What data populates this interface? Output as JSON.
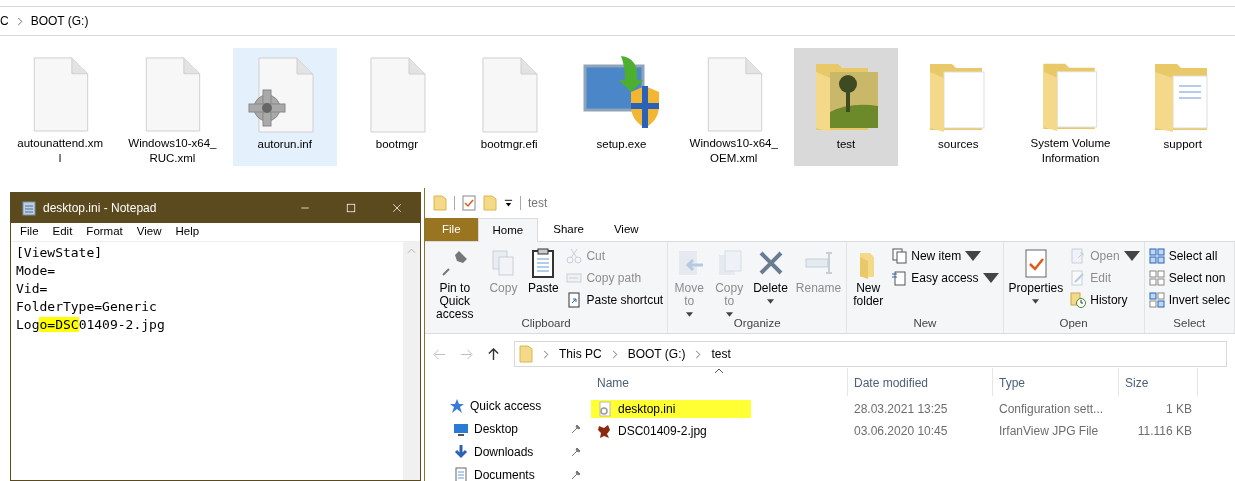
{
  "background_explorer": {
    "breadcrumb": [
      "C",
      "BOOT (G:)"
    ],
    "items": [
      {
        "lines": [
          "autounattend.xm",
          "l"
        ],
        "kind": "file",
        "selected": false,
        "hovered": false
      },
      {
        "lines": [
          "Windows10-x64_",
          "RUC.xml"
        ],
        "kind": "file",
        "selected": false,
        "hovered": false
      },
      {
        "lines": [
          "autorun.inf"
        ],
        "kind": "settings-file",
        "selected": false,
        "hovered": true
      },
      {
        "lines": [
          "bootmgr"
        ],
        "kind": "file",
        "selected": false,
        "hovered": false
      },
      {
        "lines": [
          "bootmgr.efi"
        ],
        "kind": "file",
        "selected": false,
        "hovered": false
      },
      {
        "lines": [
          "setup.exe"
        ],
        "kind": "setup",
        "selected": false,
        "hovered": false
      },
      {
        "lines": [
          "Windows10-x64_",
          "OEM.xml"
        ],
        "kind": "file",
        "selected": false,
        "hovered": false
      },
      {
        "lines": [
          "test"
        ],
        "kind": "photo-folder",
        "selected": true,
        "hovered": false
      },
      {
        "lines": [
          "sources"
        ],
        "kind": "folder",
        "selected": false,
        "hovered": false
      },
      {
        "lines": [
          "System Volume",
          "Information"
        ],
        "kind": "folder",
        "selected": false,
        "hovered": false
      },
      {
        "lines": [
          "support"
        ],
        "kind": "doc-folder",
        "selected": false,
        "hovered": false
      }
    ]
  },
  "notepad": {
    "title": "desktop.ini - Notepad",
    "menu": [
      "File",
      "Edit",
      "Format",
      "View",
      "Help"
    ],
    "lines": [
      {
        "segments": [
          {
            "text": "[ViewState]",
            "highlighted": false
          }
        ]
      },
      {
        "segments": [
          {
            "text": "Mode=",
            "highlighted": false
          }
        ]
      },
      {
        "segments": [
          {
            "text": "Vid=",
            "highlighted": false
          }
        ]
      },
      {
        "segments": [
          {
            "text": "FolderType=Generic",
            "highlighted": false
          }
        ]
      },
      {
        "segments": [
          {
            "text": "Log",
            "highlighted": false
          },
          {
            "text": "o=DSC",
            "highlighted": true
          },
          {
            "text": "01409-2.jpg",
            "highlighted": false
          }
        ]
      }
    ]
  },
  "explorer": {
    "title": "test",
    "tabs": [
      {
        "label": "File",
        "kind": "file-menu",
        "selected": false
      },
      {
        "label": "Home",
        "kind": "tab",
        "selected": true
      },
      {
        "label": "Share",
        "kind": "tab",
        "selected": false
      },
      {
        "label": "View",
        "kind": "tab",
        "selected": false
      }
    ],
    "ribbon": [
      {
        "label": "Clipboard",
        "items": [
          {
            "kind": "pin",
            "lines": [
              "Pin to Quick",
              "access"
            ],
            "disabled": false,
            "dropdown": false
          },
          {
            "kind": "copy",
            "lines": [
              "Copy"
            ],
            "disabled": true,
            "dropdown": false
          },
          {
            "kind": "paste",
            "lines": [
              "Paste"
            ],
            "disabled": false,
            "dropdown": false
          },
          {
            "kind": "stack",
            "items": [
              {
                "kind": "cut",
                "label": "Cut",
                "disabled": true,
                "dropdown": false
              },
              {
                "kind": "copypath",
                "label": "Copy path",
                "disabled": true,
                "dropdown": false
              },
              {
                "kind": "shortcut",
                "label": "Paste shortcut",
                "disabled": false,
                "dropdown": false
              }
            ]
          }
        ]
      },
      {
        "label": "Organize",
        "items": [
          {
            "kind": "move",
            "lines": [
              "Move",
              "to"
            ],
            "disabled": true,
            "dropdown": true
          },
          {
            "kind": "copyto",
            "lines": [
              "Copy",
              "to"
            ],
            "disabled": true,
            "dropdown": true
          },
          {
            "kind": "delete",
            "lines": [
              "Delete"
            ],
            "disabled": false,
            "dropdown": true
          },
          {
            "kind": "rename",
            "lines": [
              "Rename"
            ],
            "disabled": true,
            "dropdown": false
          }
        ]
      },
      {
        "label": "New",
        "items": [
          {
            "kind": "newfolder",
            "lines": [
              "New",
              "folder"
            ],
            "disabled": false,
            "dropdown": false
          },
          {
            "kind": "stack",
            "items": [
              {
                "kind": "newitem",
                "label": "New item",
                "disabled": false,
                "dropdown": true
              },
              {
                "kind": "easyaccess",
                "label": "Easy access",
                "disabled": false,
                "dropdown": true
              }
            ]
          }
        ]
      },
      {
        "label": "Open",
        "items": [
          {
            "kind": "properties",
            "lines": [
              "Properties"
            ],
            "disabled": false,
            "dropdown": true
          },
          {
            "kind": "stack",
            "items": [
              {
                "kind": "open",
                "label": "Open",
                "disabled": true,
                "dropdown": true
              },
              {
                "kind": "edit",
                "label": "Edit",
                "disabled": true,
                "dropdown": false
              },
              {
                "kind": "history",
                "label": "History",
                "disabled": false,
                "dropdown": false
              }
            ]
          }
        ]
      },
      {
        "label": "Select",
        "items": [
          {
            "kind": "stack",
            "items": [
              {
                "kind": "selectall",
                "label": "Select all",
                "disabled": false,
                "dropdown": false
              },
              {
                "kind": "selectnone",
                "label": "Select non",
                "disabled": false,
                "dropdown": false
              },
              {
                "kind": "invert",
                "label": "Invert selec",
                "disabled": false,
                "dropdown": false
              }
            ]
          }
        ]
      }
    ],
    "breadcrumb": [
      "This PC",
      "BOOT (G:)",
      "test"
    ],
    "nav": [
      {
        "label": "Quick access",
        "kind": "quick",
        "pinned": false
      },
      {
        "label": "Desktop",
        "kind": "desktop",
        "pinned": true
      },
      {
        "label": "Downloads",
        "kind": "downloads",
        "pinned": true
      },
      {
        "label": "Documents",
        "kind": "documents",
        "pinned": true
      }
    ],
    "columns": [
      {
        "label": "Name",
        "sorted": true
      },
      {
        "label": "Date modified",
        "sorted": false
      },
      {
        "label": "Type",
        "sorted": false
      },
      {
        "label": "Size",
        "sorted": false
      }
    ],
    "rows": [
      {
        "kind": "settings",
        "name": "desktop.ini",
        "date": "28.03.2021 13:25",
        "type": "Configuration sett...",
        "size": "1 KB",
        "highlighted": true
      },
      {
        "kind": "image",
        "name": "DSC01409-2.jpg",
        "date": "03.06.2020 10:45",
        "type": "IrfanView JPG File",
        "size": "11.116 KB",
        "highlighted": false
      }
    ]
  }
}
